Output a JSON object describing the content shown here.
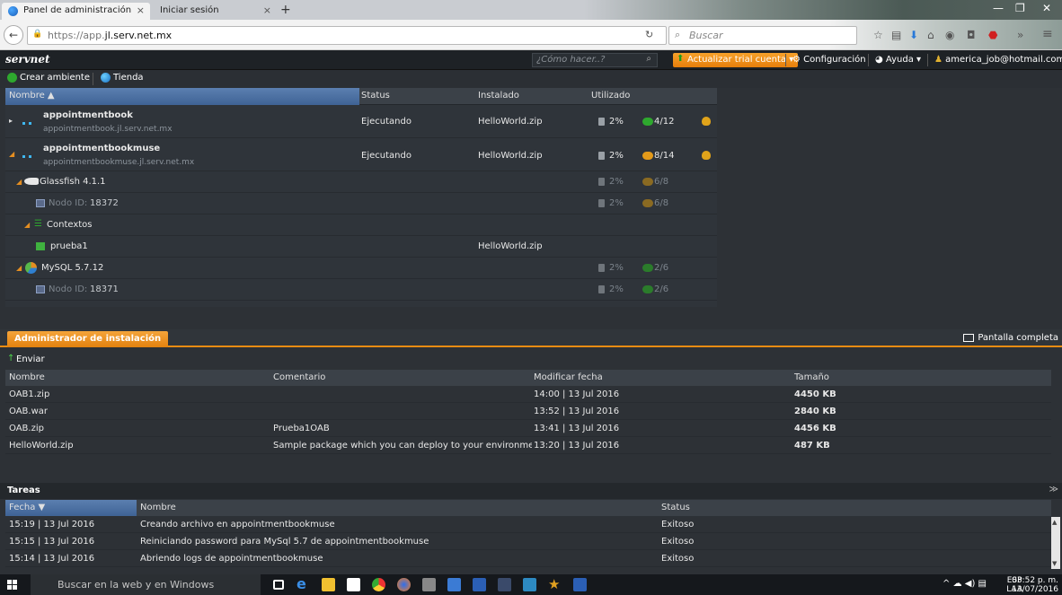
{
  "browser": {
    "tabs": [
      {
        "label": "Panel de administración",
        "close": "×"
      },
      {
        "label": "Iniciar sesión",
        "close": "×"
      }
    ],
    "new_tab": "+",
    "url_prefix": "https://app.",
    "url_host": "jl.serv.net.mx",
    "search_placeholder": "Buscar"
  },
  "header": {
    "brand": "servnet",
    "howto_placeholder": "¿Cómo hacer..?",
    "upgrade_label": "Actualizar trial cuenta",
    "config_label": "Configuración",
    "help_label": "Ayuda",
    "user_label": "america_job@hotmail.com"
  },
  "env_toolbar": {
    "create_label": "Crear ambiente",
    "store_label": "Tienda"
  },
  "env_grid": {
    "columns": {
      "name": "Nombre ▲",
      "status": "Status",
      "installed": "Instalado",
      "used": "Utilizado"
    },
    "envs": [
      {
        "name": "appointmentbook",
        "domain": "appointmentbook.jl.serv.net.mx",
        "status": "Ejecutando",
        "installed": "HelloWorld.zip",
        "disk": "2%",
        "cloudlets": "4/12"
      },
      {
        "name": "appointmentbookmuse",
        "domain": "appointmentbookmuse.jl.serv.net.mx",
        "status": "Ejecutando",
        "installed": "HelloWorld.zip",
        "disk": "2%",
        "cloudlets": "8/14"
      }
    ],
    "glassfish": {
      "name": "Glassfish 4.1.1",
      "disk": "2%",
      "cloudlets": "6/8"
    },
    "glassfish_node": {
      "label": "Nodo ID:",
      "id": "18372",
      "disk": "2%",
      "cloudlets": "6/8"
    },
    "contexts": {
      "label": "Contextos"
    },
    "context_item": {
      "name": "prueba1",
      "installed": "HelloWorld.zip"
    },
    "mysql": {
      "name": "MySQL 5.7.12",
      "disk": "2%",
      "cloudlets": "2/6"
    },
    "mysql_node": {
      "label": "Nodo ID:",
      "id": "18371",
      "disk": "2%",
      "cloudlets": "2/6"
    }
  },
  "installer": {
    "tab_label": "Administrador de instalación",
    "fullscreen_label": "Pantalla completa",
    "send_label": "Enviar",
    "columns": {
      "name": "Nombre",
      "comment": "Comentario",
      "modified": "Modificar fecha",
      "size": "Tamaño"
    },
    "rows": [
      {
        "name": "OAB1.zip",
        "comment": "",
        "modified": "14:00 | 13 Jul 2016",
        "size": "4450 KB"
      },
      {
        "name": "OAB.war",
        "comment": "",
        "modified": "13:52 | 13 Jul 2016",
        "size": "2840 KB"
      },
      {
        "name": "OAB.zip",
        "comment": "Prueba1OAB",
        "modified": "13:41 | 13 Jul 2016",
        "size": "4456 KB"
      },
      {
        "name": "HelloWorld.zip",
        "comment": "Sample package which you can deploy to your environment. Feel...",
        "modified": "13:20 | 13 Jul 2016",
        "size": "487 KB"
      }
    ]
  },
  "tasks": {
    "title": "Tareas",
    "columns": {
      "date": "Fecha ▼",
      "name": "Nombre",
      "status": "Status"
    },
    "rows": [
      {
        "date": "15:19 | 13 Jul 2016",
        "name": "Creando archivo en appointmentbookmuse",
        "status": "Exitoso"
      },
      {
        "date": "15:15 | 13 Jul 2016",
        "name": "Reiniciando password para MySql 5.7 de appointmentbookmuse",
        "status": "Exitoso"
      },
      {
        "date": "15:14 | 13 Jul 2016",
        "name": "Abriendo logs de appointmentbookmuse",
        "status": "Exitoso"
      }
    ]
  },
  "taskbar": {
    "search_placeholder": "Buscar en la web y en Windows",
    "lang_top": "ESP",
    "lang_bottom": "LAA",
    "time": "03:52 p. m.",
    "date": "13/07/2016"
  },
  "colors": {
    "accent_orange": "#e98c12",
    "green": "#2ea82e",
    "header_bg": "#1e2226",
    "panel_bg": "#2d3136"
  }
}
